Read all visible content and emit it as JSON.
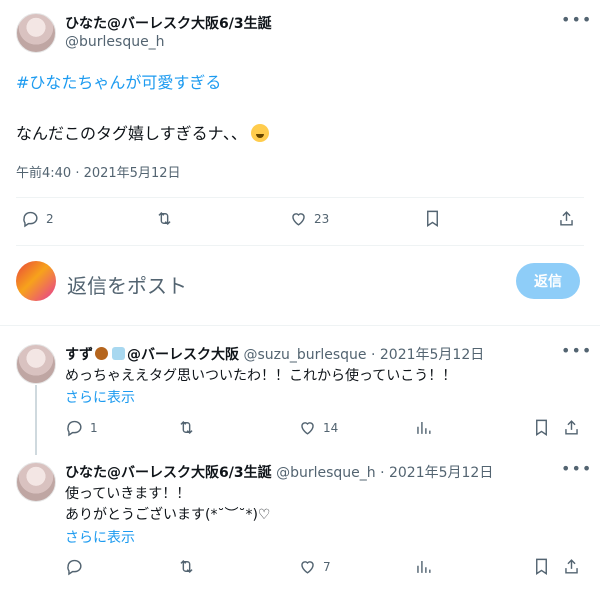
{
  "main_tweet": {
    "display_name": "ひなた@バーレスク大阪6/3生誕",
    "handle": "@burlesque_h",
    "hashtag": "#ひなたちゃんが可愛すぎる",
    "body": "なんだこのタグ嬉しすぎるナ、、",
    "emoji": "loudly-crying-face",
    "timestamp": "午前4:40 · 2021年5月12日",
    "replies": "2",
    "retweets": "",
    "likes": "23"
  },
  "compose": {
    "placeholder": "返信をポスト",
    "button_label": "返信"
  },
  "replies": [
    {
      "display_name": "すず",
      "name_suffix": "@バーレスク大阪",
      "handle": "@suzu_burlesque",
      "date": "2021年5月12日",
      "text": "めっちゃええタグ思いついたわ！！これから使っていこう！！",
      "show_more": "さらに表示",
      "replies": "1",
      "likes": "14"
    },
    {
      "display_name": "ひなた@バーレスク大阪6/3生誕",
      "handle": "@burlesque_h",
      "date": "2021年5月12日",
      "text_line1": "使っていきます！！",
      "text_line2": "ありがとうございます(*˘︶˘*)♡",
      "show_more": "さらに表示",
      "replies": "",
      "likes": "7"
    }
  ],
  "separator": "·",
  "icons": {
    "more": "more-icon",
    "reply": "reply-icon",
    "retweet": "retweet-icon",
    "like": "heart-icon",
    "views": "views-icon",
    "bookmark": "bookmark-icon",
    "share": "share-icon"
  },
  "colors": {
    "link": "#1d9bf0",
    "muted": "#536471",
    "text": "#0f1419",
    "reply_button": "#8ecdf8"
  }
}
